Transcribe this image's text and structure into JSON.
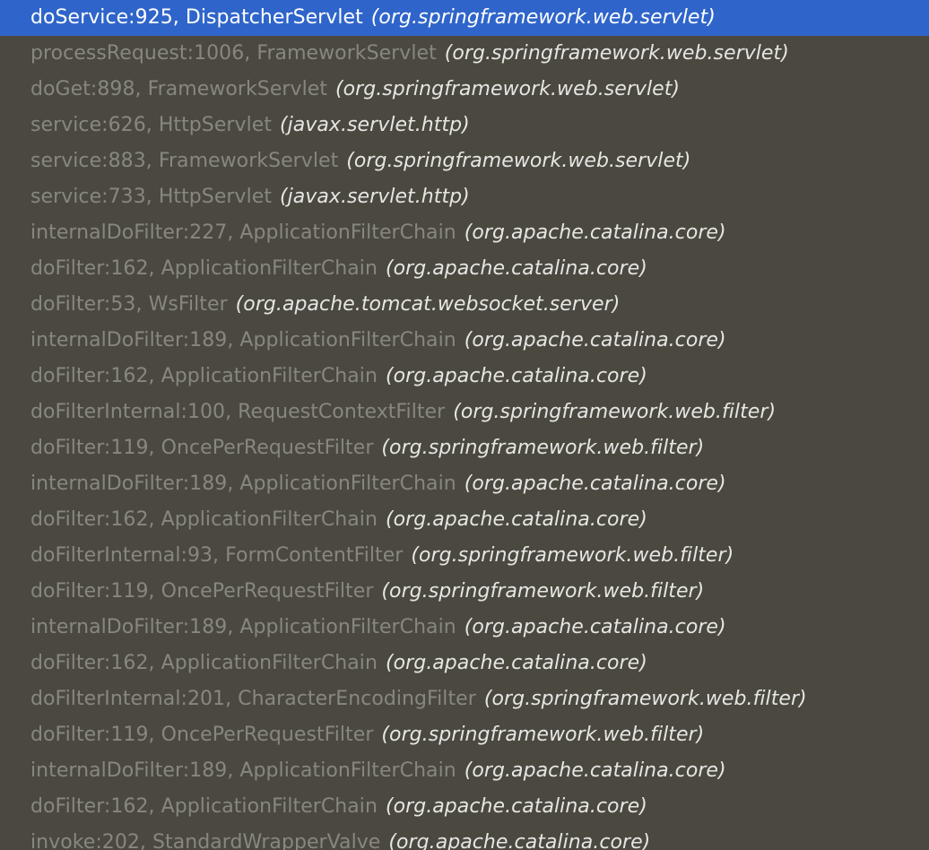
{
  "frames_panel": {
    "selected_index": 0,
    "frames": [
      {
        "method": "doService:925, DispatcherServlet",
        "package": "(org.springframework.web.servlet)"
      },
      {
        "method": "processRequest:1006, FrameworkServlet",
        "package": "(org.springframework.web.servlet)"
      },
      {
        "method": "doGet:898, FrameworkServlet",
        "package": "(org.springframework.web.servlet)"
      },
      {
        "method": "service:626, HttpServlet",
        "package": "(javax.servlet.http)"
      },
      {
        "method": "service:883, FrameworkServlet",
        "package": "(org.springframework.web.servlet)"
      },
      {
        "method": "service:733, HttpServlet",
        "package": "(javax.servlet.http)"
      },
      {
        "method": "internalDoFilter:227, ApplicationFilterChain",
        "package": "(org.apache.catalina.core)"
      },
      {
        "method": "doFilter:162, ApplicationFilterChain",
        "package": "(org.apache.catalina.core)"
      },
      {
        "method": "doFilter:53, WsFilter",
        "package": "(org.apache.tomcat.websocket.server)"
      },
      {
        "method": "internalDoFilter:189, ApplicationFilterChain",
        "package": "(org.apache.catalina.core)"
      },
      {
        "method": "doFilter:162, ApplicationFilterChain",
        "package": "(org.apache.catalina.core)"
      },
      {
        "method": "doFilterInternal:100, RequestContextFilter",
        "package": "(org.springframework.web.filter)"
      },
      {
        "method": "doFilter:119, OncePerRequestFilter",
        "package": "(org.springframework.web.filter)"
      },
      {
        "method": "internalDoFilter:189, ApplicationFilterChain",
        "package": "(org.apache.catalina.core)"
      },
      {
        "method": "doFilter:162, ApplicationFilterChain",
        "package": "(org.apache.catalina.core)"
      },
      {
        "method": "doFilterInternal:93, FormContentFilter",
        "package": "(org.springframework.web.filter)"
      },
      {
        "method": "doFilter:119, OncePerRequestFilter",
        "package": "(org.springframework.web.filter)"
      },
      {
        "method": "internalDoFilter:189, ApplicationFilterChain",
        "package": "(org.apache.catalina.core)"
      },
      {
        "method": "doFilter:162, ApplicationFilterChain",
        "package": "(org.apache.catalina.core)"
      },
      {
        "method": "doFilterInternal:201, CharacterEncodingFilter",
        "package": "(org.springframework.web.filter)"
      },
      {
        "method": "doFilter:119, OncePerRequestFilter",
        "package": "(org.springframework.web.filter)"
      },
      {
        "method": "internalDoFilter:189, ApplicationFilterChain",
        "package": "(org.apache.catalina.core)"
      },
      {
        "method": "doFilter:162, ApplicationFilterChain",
        "package": "(org.apache.catalina.core)"
      },
      {
        "method": "invoke:202, StandardWrapperValve",
        "package": "(org.apache.catalina.core)"
      }
    ]
  },
  "colors": {
    "background": "#4b4840",
    "selection": "#2f65ca",
    "method_text": "#878780",
    "package_text": "#e6e6e2",
    "selected_text": "#ffffff"
  }
}
